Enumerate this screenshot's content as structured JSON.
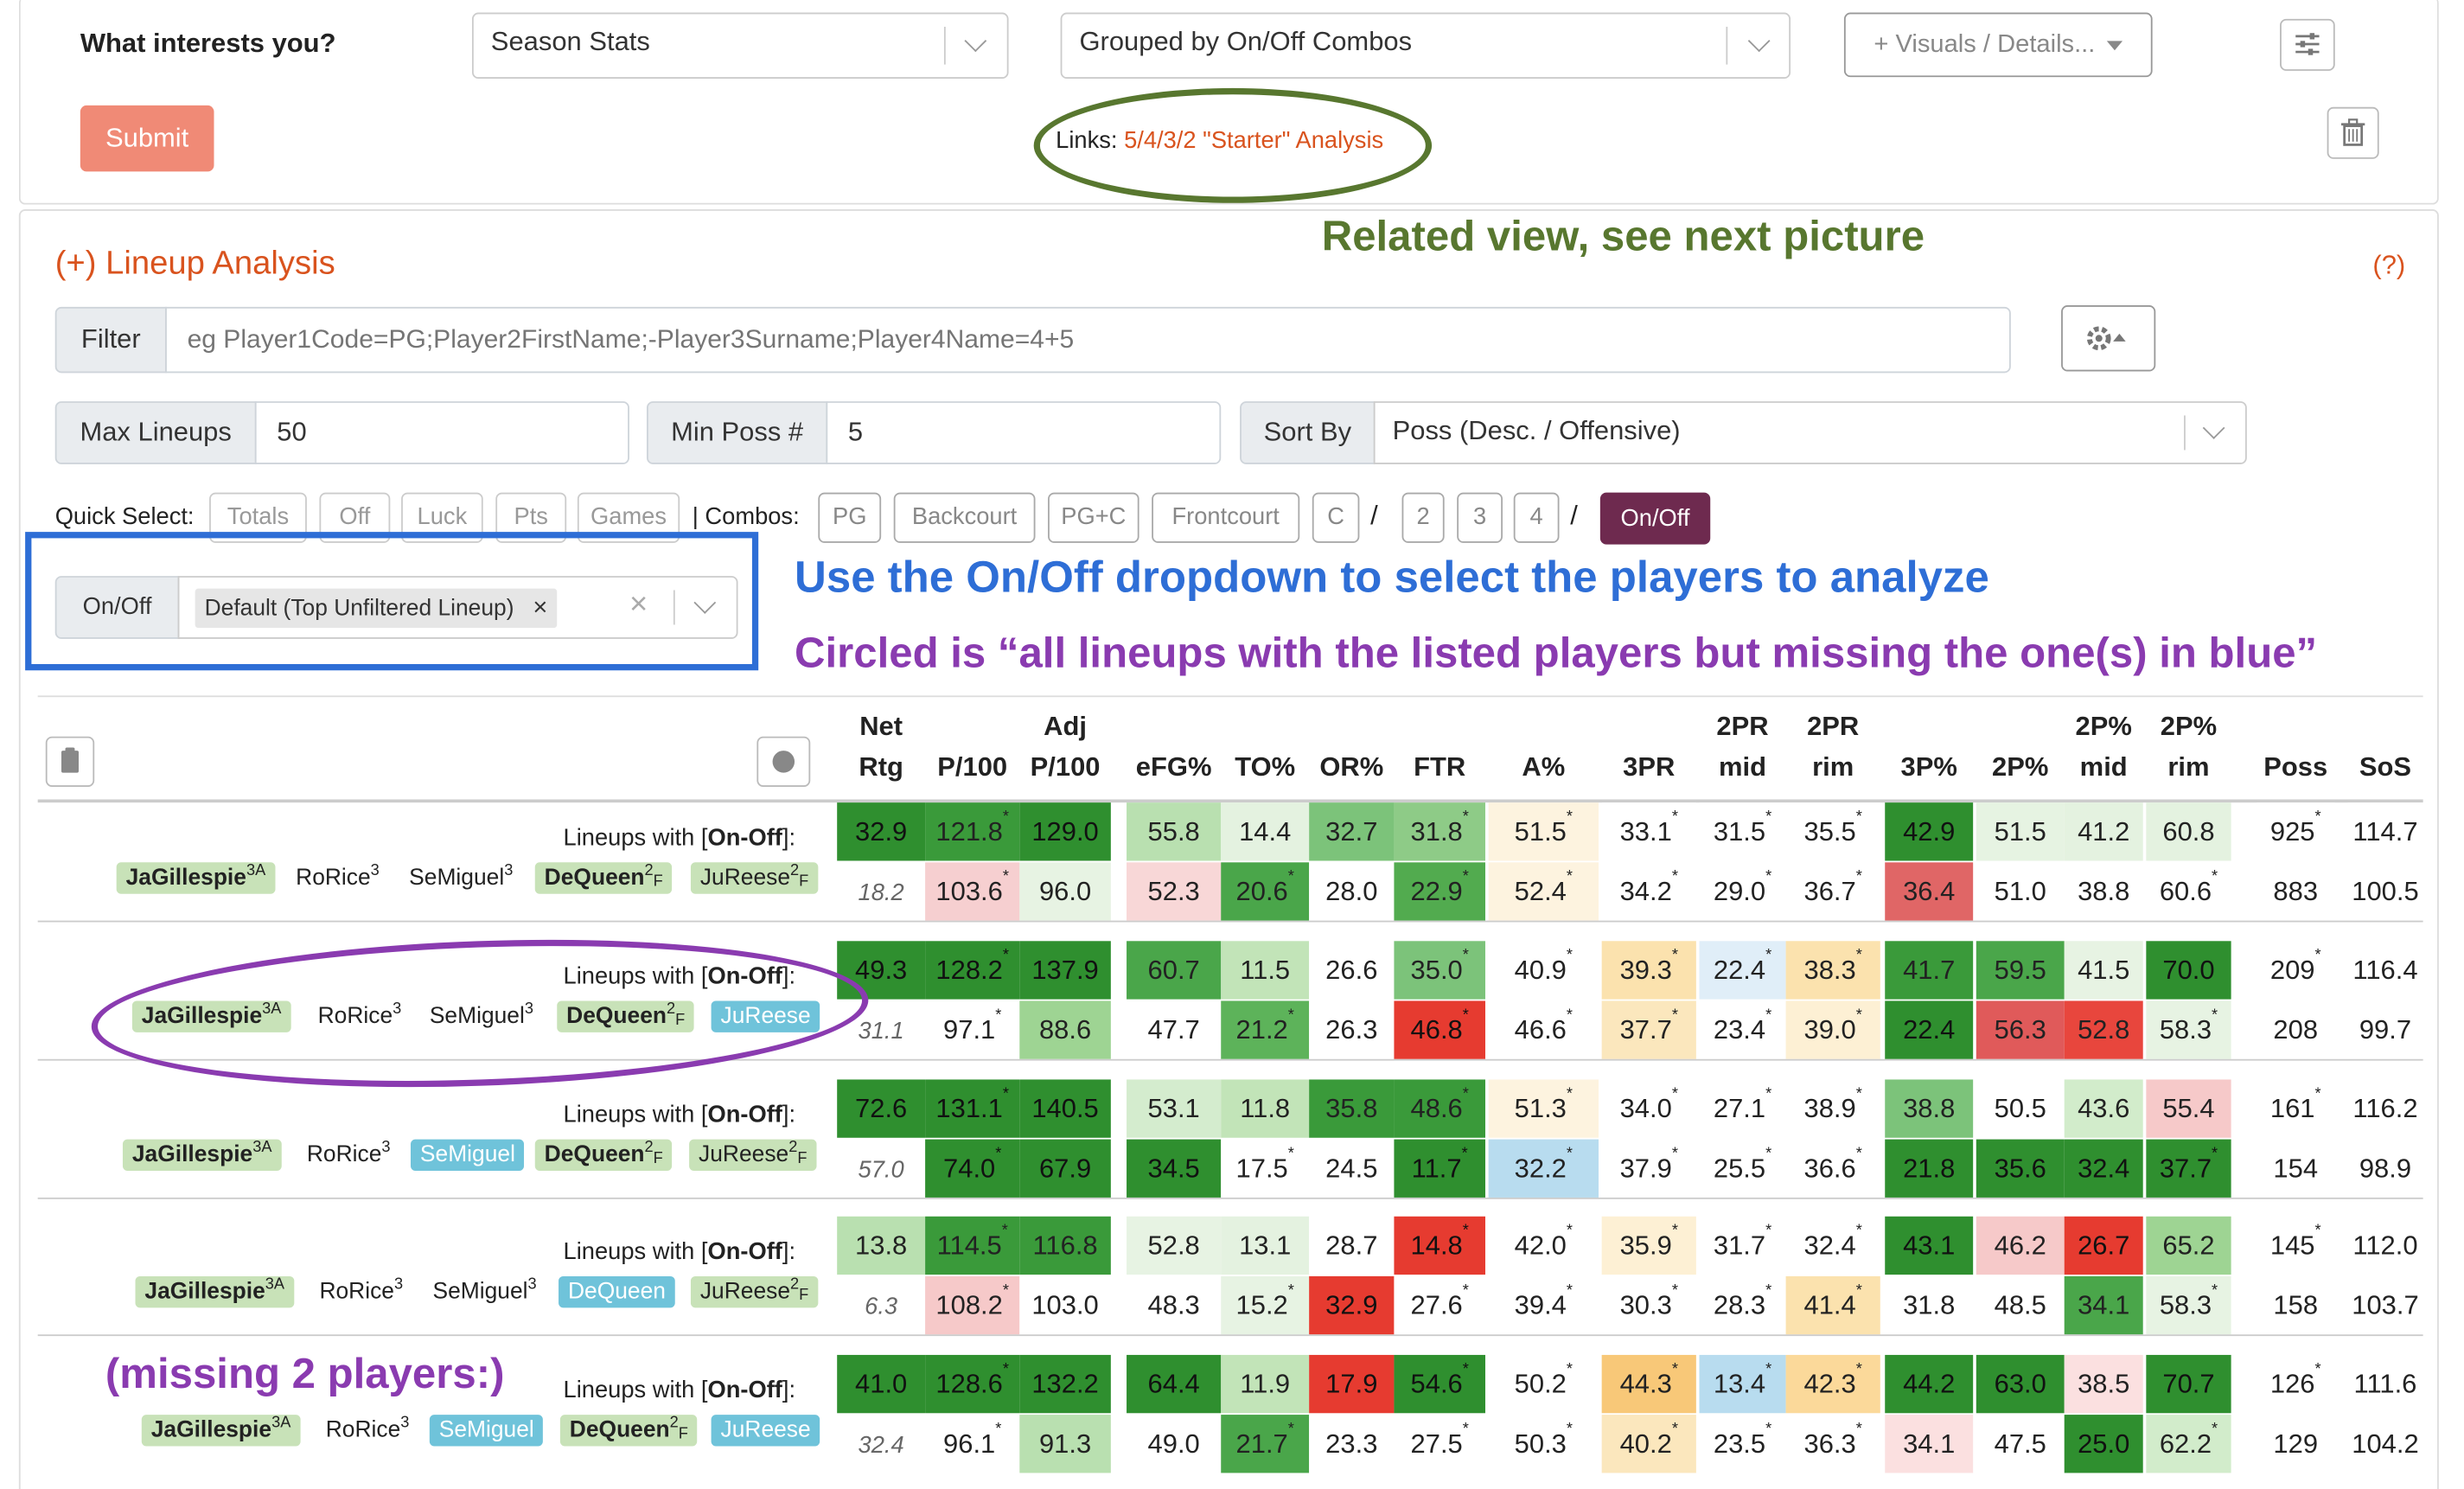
{
  "top_bar": {
    "question_label": "What interests you?",
    "view_select": "Season Stats",
    "group_select": "Grouped by On/Off Combos",
    "visuals_button": "+ Visuals / Details...",
    "submit_label": "Submit",
    "links_prefix": "Links: ",
    "links_link": "5/4/3/2 \"Starter\" Analysis"
  },
  "lineup": {
    "title": "(+) Lineup Analysis",
    "help": "(?)",
    "filter_label": "Filter",
    "filter_placeholder": "eg Player1Code=PG;Player2FirstName;-Player3Surname;Player4Name=4+5",
    "max_lineups_label": "Max Lineups",
    "max_lineups_value": "50",
    "min_poss_label": "Min Poss #",
    "min_poss_value": "5",
    "sort_label": "Sort By",
    "sort_value": "Poss (Desc. / Offensive)",
    "quick_select_label": "Quick Select:",
    "quick_select": [
      "Totals",
      "Off",
      "Luck",
      "Pts",
      "Games"
    ],
    "combos_label": "| Combos:",
    "combos": [
      "PG",
      "Backcourt",
      "PG+C",
      "Frontcourt",
      "C"
    ],
    "slash": "/",
    "numbers": [
      "2",
      "3",
      "4"
    ],
    "onoff_button": "On/Off",
    "onoff_label": "On/Off",
    "onoff_tag": "Default (Top Unfiltered Lineup)",
    "tag_x": "×",
    "clear_x": "×"
  },
  "annotations": {
    "related": "Related view, see next picture",
    "use_onoff": "Use the On/Off dropdown to select the players to analyze",
    "circled": "Circled is “all lineups with the listed players but missing the one(s) in blue”",
    "missing2": "(missing 2 players:)"
  },
  "colors": {
    "accent": "#e0574a",
    "orange_text": "#d9531e",
    "green_annot": "#58772f",
    "blue_annot": "#2e6ed6",
    "purple_annot": "#8a3bb0",
    "onoff_btn": "#6e2a4f"
  },
  "table": {
    "headers": [
      {
        "top": "Net",
        "bot": "Rtg"
      },
      {
        "top": "",
        "bot": "P/100"
      },
      {
        "top": "Adj",
        "bot": "P/100"
      },
      {
        "top": "",
        "bot": "eFG%"
      },
      {
        "top": "",
        "bot": "TO%"
      },
      {
        "top": "",
        "bot": "OR%"
      },
      {
        "top": "",
        "bot": "FTR"
      },
      {
        "top": "",
        "bot": "A%"
      },
      {
        "top": "",
        "bot": "3PR"
      },
      {
        "top": "2PR",
        "bot": "mid"
      },
      {
        "top": "2PR",
        "bot": "rim"
      },
      {
        "top": "",
        "bot": "3P%"
      },
      {
        "top": "",
        "bot": "2P%"
      },
      {
        "top": "2P%",
        "bot": "mid"
      },
      {
        "top": "2P%",
        "bot": "rim"
      },
      {
        "top": "",
        "bot": "Poss"
      },
      {
        "top": "",
        "bot": "SoS"
      }
    ],
    "lineups_with_label": "Lineups with [",
    "on_off_text": "On-Off",
    "lineups_with_end": "]:",
    "groups": [
      {
        "players": [
          {
            "name": "JaGillespie",
            "pos": "3A",
            "style": "g",
            "bold": true
          },
          {
            "name": "RoRice",
            "pos": "3",
            "style": "",
            "bold": false
          },
          {
            "name": "SeMiguel",
            "pos": "3",
            "style": "",
            "bold": false
          },
          {
            "name": "DeQueen",
            "pos": "2",
            "sub": "F",
            "style": "g",
            "bold": true
          },
          {
            "name": "JuReese",
            "pos": "2",
            "sub": "F",
            "style": "g",
            "bold": false
          }
        ],
        "rows": [
          [
            "32.9",
            "121.8*",
            "129.0",
            "55.8",
            "14.4",
            "32.7",
            "31.8*",
            "51.5*",
            "33.1*",
            "31.5*",
            "35.5*",
            "42.9",
            "51.5",
            "41.2",
            "60.8",
            "925*",
            "114.7"
          ],
          [
            "18.2",
            "103.6*",
            "96.0",
            "52.3",
            "20.6*",
            "28.0",
            "22.9*",
            "52.4*",
            "34.2*",
            "29.0*",
            "36.7*",
            "36.4",
            "51.0",
            "38.8",
            "60.6*",
            "883",
            "100.5"
          ]
        ],
        "colors": [
          [
            "#2f8f2f",
            "#3a9a3a",
            "#2f8f2f",
            "#b9e0b0",
            "#e4f2e0",
            "#7cc37a",
            "#8ecb87",
            "#fdf3df",
            "#fff",
            "#fff",
            "#fff",
            "#2f8f2f",
            "#e6f3e2",
            "#e4f2e0",
            "#e4f2e0",
            "#fff",
            "#fff"
          ],
          [
            "#fff",
            "#f6cfd0",
            "#e7f3e3",
            "#f8d7d7",
            "#4aa64a",
            "#fff",
            "#52ab4f",
            "#fdf3df",
            "#fff",
            "#fff",
            "#fff",
            "#e06666",
            "#fff",
            "#fff",
            "#fff",
            "#fff",
            "#fff"
          ]
        ]
      },
      {
        "players": [
          {
            "name": "JaGillespie",
            "pos": "3A",
            "style": "g",
            "bold": true
          },
          {
            "name": "RoRice",
            "pos": "3",
            "style": "",
            "bold": false
          },
          {
            "name": "SeMiguel",
            "pos": "3",
            "style": "",
            "bold": false
          },
          {
            "name": "DeQueen",
            "pos": "2",
            "sub": "F",
            "style": "g",
            "bold": true
          },
          {
            "name": "JuReese",
            "pos": "",
            "style": "b",
            "bold": false
          }
        ],
        "rows": [
          [
            "49.3",
            "128.2*",
            "137.9",
            "60.7",
            "11.5",
            "26.6",
            "35.0*",
            "40.9*",
            "39.3*",
            "22.4*",
            "38.3*",
            "41.7",
            "59.5",
            "41.5",
            "70.0",
            "209*",
            "116.4"
          ],
          [
            "31.1",
            "97.1*",
            "88.6",
            "47.7",
            "21.2*",
            "26.3",
            "46.8*",
            "46.6*",
            "37.7*",
            "23.4*",
            "39.0*",
            "22.4",
            "56.3",
            "52.8",
            "58.3*",
            "208",
            "99.7"
          ]
        ],
        "colors": [
          [
            "#2f8f2f",
            "#2f8f2f",
            "#2f8f2f",
            "#4aa64a",
            "#c2e4b8",
            "#fff",
            "#7cc37a",
            "#fff",
            "#fbe2ae",
            "#e0eef8",
            "#fbe2ae",
            "#3a9a3a",
            "#4aa64a",
            "#e7f3e3",
            "#2f8f2f",
            "#fff",
            "#fff"
          ],
          [
            "#fff",
            "#fff",
            "#9ed493",
            "#fff",
            "#5db35a",
            "#fff",
            "#e63b30",
            "#fff",
            "#fbe7bd",
            "#fff",
            "#fdf0d4",
            "#2f8f2f",
            "#e05a5a",
            "#e8463d",
            "#e7f3e3",
            "#fff",
            "#fff"
          ]
        ]
      },
      {
        "players": [
          {
            "name": "JaGillespie",
            "pos": "3A",
            "style": "g",
            "bold": true
          },
          {
            "name": "RoRice",
            "pos": "3",
            "style": "",
            "bold": false
          },
          {
            "name": "SeMiguel",
            "pos": "",
            "style": "b",
            "bold": false
          },
          {
            "name": "DeQueen",
            "pos": "2",
            "sub": "F",
            "style": "g",
            "bold": true
          },
          {
            "name": "JuReese",
            "pos": "2",
            "sub": "F",
            "style": "g",
            "bold": false
          }
        ],
        "rows": [
          [
            "72.6",
            "131.1*",
            "140.5",
            "53.1",
            "11.8",
            "35.8",
            "48.6*",
            "51.3*",
            "34.0*",
            "27.1*",
            "38.9*",
            "38.8",
            "50.5",
            "43.6",
            "55.4",
            "161*",
            "116.2"
          ],
          [
            "57.0",
            "74.0*",
            "67.9",
            "34.5",
            "17.5*",
            "24.5",
            "11.7*",
            "32.2*",
            "37.9*",
            "25.5*",
            "36.6*",
            "21.8",
            "35.6",
            "32.4",
            "37.7*",
            "154",
            "98.9"
          ]
        ],
        "colors": [
          [
            "#2f8f2f",
            "#2f8f2f",
            "#2f8f2f",
            "#d4ecce",
            "#c2e4b8",
            "#3a9a3a",
            "#3a9a3a",
            "#fdf3df",
            "#fff",
            "#fff",
            "#fff",
            "#7cc37a",
            "#fff",
            "#d2eccb",
            "#f6c9c9",
            "#fff",
            "#fff"
          ],
          [
            "#fff",
            "#2f8f2f",
            "#2f8f2f",
            "#2f8f2f",
            "#fff",
            "#fff",
            "#2f8f2f",
            "#b8dcef",
            "#fff",
            "#fff",
            "#fff",
            "#2f8f2f",
            "#2f8f2f",
            "#2f8f2f",
            "#2f8f2f",
            "#fff",
            "#fff"
          ]
        ]
      },
      {
        "players": [
          {
            "name": "JaGillespie",
            "pos": "3A",
            "style": "g",
            "bold": true
          },
          {
            "name": "RoRice",
            "pos": "3",
            "style": "",
            "bold": false
          },
          {
            "name": "SeMiguel",
            "pos": "3",
            "style": "",
            "bold": false
          },
          {
            "name": "DeQueen",
            "pos": "",
            "style": "b",
            "bold": false
          },
          {
            "name": "JuReese",
            "pos": "2",
            "sub": "F",
            "style": "g",
            "bold": false
          }
        ],
        "rows": [
          [
            "13.8",
            "114.5*",
            "116.8",
            "52.8",
            "13.1",
            "28.7",
            "14.8*",
            "42.0*",
            "35.9*",
            "31.7*",
            "32.4*",
            "43.1",
            "46.2",
            "26.7",
            "65.2",
            "145*",
            "112.0"
          ],
          [
            "6.3",
            "108.2*",
            "103.0",
            "48.3",
            "15.2*",
            "32.9",
            "27.6*",
            "39.4*",
            "30.3*",
            "28.3*",
            "41.4*",
            "31.8",
            "48.5",
            "34.1",
            "58.3*",
            "158",
            "103.7"
          ]
        ],
        "colors": [
          [
            "#b9e0b0",
            "#3a9a3a",
            "#3a9a3a",
            "#e7f3e3",
            "#e4f2e0",
            "#fff",
            "#e63b30",
            "#fff",
            "#fdf0d4",
            "#fff",
            "#fff",
            "#2f8f2f",
            "#f6c9c9",
            "#e63b30",
            "#9ed493",
            "#fff",
            "#fff"
          ],
          [
            "#fff",
            "#f6c9c9",
            "#fff",
            "#fff",
            "#e7f3e3",
            "#e63b30",
            "#fff",
            "#fff",
            "#fff",
            "#fff",
            "#fbe2ae",
            "#fff",
            "#fff",
            "#4aa64a",
            "#e7f3e3",
            "#fff",
            "#fff"
          ]
        ]
      },
      {
        "players": [
          {
            "name": "JaGillespie",
            "pos": "3A",
            "style": "g",
            "bold": true
          },
          {
            "name": "RoRice",
            "pos": "3",
            "style": "",
            "bold": false
          },
          {
            "name": "SeMiguel",
            "pos": "",
            "style": "b",
            "bold": false
          },
          {
            "name": "DeQueen",
            "pos": "2",
            "sub": "F",
            "style": "g",
            "bold": true
          },
          {
            "name": "JuReese",
            "pos": "",
            "style": "b",
            "bold": false
          }
        ],
        "rows": [
          [
            "41.0",
            "128.6*",
            "132.2",
            "64.4",
            "11.9",
            "17.9",
            "54.6*",
            "50.2*",
            "44.3*",
            "13.4*",
            "42.3*",
            "44.2",
            "63.0",
            "38.5",
            "70.7",
            "126*",
            "111.6"
          ],
          [
            "32.4",
            "96.1*",
            "91.3",
            "49.0",
            "21.7*",
            "23.3",
            "27.5*",
            "50.3*",
            "40.2*",
            "23.5*",
            "36.3*",
            "34.1",
            "47.5",
            "25.0",
            "62.2*",
            "129",
            "104.2"
          ]
        ],
        "colors": [
          [
            "#2f8f2f",
            "#2f8f2f",
            "#2f8f2f",
            "#2f8f2f",
            "#c2e4b8",
            "#e63b30",
            "#2f8f2f",
            "#fff",
            "#f8c878",
            "#b8dcef",
            "#fbd99a",
            "#2f8f2f",
            "#2f8f2f",
            "#fbe0e0",
            "#2f8f2f",
            "#fff",
            "#fff"
          ],
          [
            "#fff",
            "#fff",
            "#b9e0b0",
            "#fff",
            "#4aa64a",
            "#fff",
            "#fff",
            "#fff",
            "#fbe7bd",
            "#fff",
            "#fff",
            "#fbe0e0",
            "#fff",
            "#2f8f2f",
            "#d2eccb",
            "#fff",
            "#fff"
          ]
        ]
      }
    ]
  }
}
